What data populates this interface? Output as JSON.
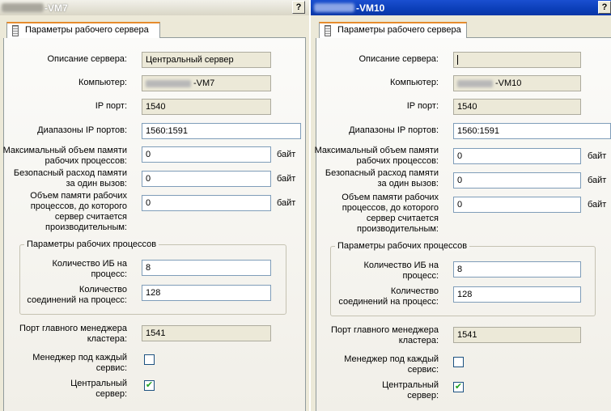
{
  "left": {
    "title_suffix": "-VM7",
    "help_label": "?",
    "tab_label": "Параметры рабочего сервера",
    "server_description": "Центральный сервер",
    "computer_suffix": "-VM7",
    "ip_port": "1540",
    "ip_port_ranges": "1560:1591",
    "max_memory": "0",
    "safe_memory": "0",
    "memory_limit": "0",
    "infobases_per_process": "8",
    "connections_per_process": "128",
    "manager_port": "1541",
    "manager_per_service_check": "",
    "central_server_check": "✔"
  },
  "right": {
    "title_suffix": "-VM10",
    "help_label": "?",
    "tab_label": "Параметры рабочего сервера",
    "server_description": "",
    "computer_suffix": "-VM10",
    "ip_port": "1540",
    "ip_port_ranges": "1560:1591",
    "max_memory": "0",
    "safe_memory": "0",
    "memory_limit": "0",
    "infobases_per_process": "8",
    "connections_per_process": "128",
    "manager_port": "1541",
    "manager_per_service_check": "",
    "central_server_check": "✔"
  },
  "labels": {
    "server_description": "Описание сервера:",
    "computer": "Компьютер:",
    "ip_port": "IP порт:",
    "ip_port_ranges": "Диапазоны IP портов:",
    "max_memory_1": "Максимальный объем памяти",
    "max_memory_2": "рабочих процессов:",
    "safe_memory_1": "Безопасный расход памяти",
    "safe_memory_2": "за один вызов:",
    "memory_limit_1": "Объем памяти рабочих",
    "memory_limit_2": "процессов, до которого",
    "memory_limit_3": "сервер считается",
    "memory_limit_4": "производительным:",
    "unit_bytes": "байт",
    "worker_group": "Параметры рабочих процессов",
    "infobases_1": "Количество ИБ на",
    "infobases_2": "процесс:",
    "connections_1": "Количество",
    "connections_2": "соединений на процесс:",
    "manager_port_1": "Порт главного менеджера",
    "manager_port_2": "кластера:",
    "manager_per_service_1": "Менеджер под каждый",
    "manager_per_service_2": "сервис:",
    "central_server_1": "Центральный",
    "central_server_2": "сервер:"
  },
  "colors": {
    "dialog_bg": "#ece9d8",
    "active_title": "#0b3eb8",
    "tab_accent": "#e68b2c",
    "check_green": "#21a121"
  }
}
